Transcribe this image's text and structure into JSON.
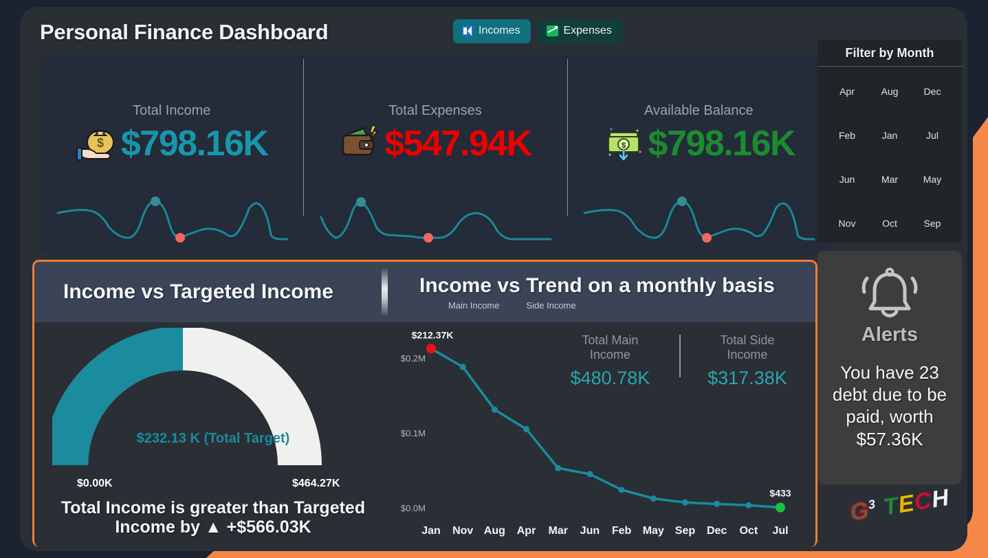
{
  "header": {
    "title": "Personal Finance Dashboard",
    "buttons": [
      {
        "label": "Incomes",
        "icon": "speaker-icon",
        "color": "#11707d"
      },
      {
        "label": "Expenses",
        "icon": "chart-up-icon",
        "color": "#113e38"
      }
    ]
  },
  "kpis": [
    {
      "label": "Total Income",
      "value": "$798.16K",
      "color": "#1896ab",
      "icon": "money-bag-in-hand-icon"
    },
    {
      "label": "Total Expenses",
      "value": "$547.94K",
      "color": "#ee0000",
      "icon": "wallet-icon"
    },
    {
      "label": "Available Balance",
      "value": "$798.16K",
      "color": "#1b8c30",
      "icon": "cash-down-arrow-icon"
    }
  ],
  "section": {
    "tab_left": "Income vs Targeted Income",
    "tab_right": "Income vs Trend on a monthly basis",
    "legend": [
      "Main Income",
      "Side Income"
    ],
    "accent": "#f07e35"
  },
  "gauge": {
    "center_label": "$232.13 K (Total Target)",
    "min_label": "$0.00K",
    "max_label": "$464.27K",
    "note_line1": "Total Income is greater than Targeted",
    "note_line2": "Income by ▲ +$566.03K",
    "fill_color": "#1b8b9e",
    "track_color": "#f0f0ef",
    "min": 0,
    "max": 464.27,
    "value": 232.13
  },
  "metrics": [
    {
      "label": "Total Main Income",
      "value": "$480.78K"
    },
    {
      "label": "Total Side Income",
      "value": "$317.38K"
    }
  ],
  "chart_data": {
    "type": "line",
    "title": "Income vs Trend on a monthly basis",
    "xlabel": "",
    "ylabel": "",
    "categories": [
      "Jan",
      "Nov",
      "Aug",
      "Apr",
      "Mar",
      "Jun",
      "Feb",
      "May",
      "Sep",
      "Dec",
      "Oct",
      "Jul"
    ],
    "values": [
      212370,
      188000,
      131000,
      105000,
      53000,
      45000,
      24000,
      12500,
      7200,
      5200,
      3400,
      433
    ],
    "ytick_labels": [
      "$0.0M",
      "$0.1M",
      "$0.2M"
    ],
    "ytick_values": [
      0,
      100000,
      200000
    ],
    "ylim": [
      0,
      212370
    ],
    "grid": false,
    "legend_position": "top",
    "line_color": "#1b8b9e",
    "first_point": {
      "label": "$212.37K",
      "color": "#ee1111"
    },
    "last_point": {
      "label": "$433",
      "color": "#18c440"
    }
  },
  "filter": {
    "title": "Filter by Month",
    "months": [
      "Apr",
      "Aug",
      "Dec",
      "Feb",
      "Jan",
      "Jul",
      "Jun",
      "Mar",
      "May",
      "Nov",
      "Oct",
      "Sep"
    ]
  },
  "alerts": {
    "icon": "bell-icon",
    "title": "Alerts",
    "message": "You have 23 debt due to be paid, worth $57.36K"
  },
  "logo": {
    "text": "G³ TECH"
  }
}
